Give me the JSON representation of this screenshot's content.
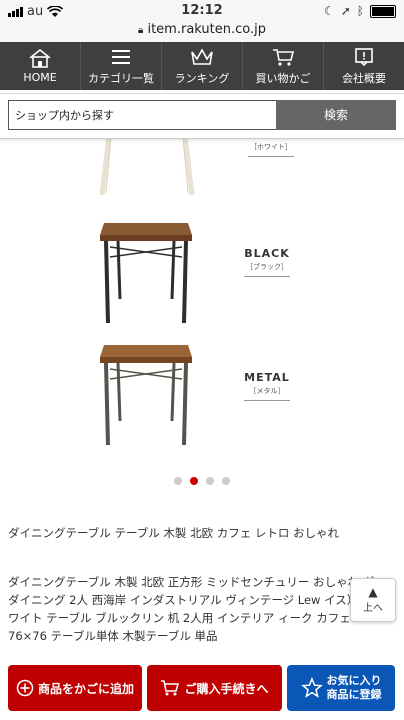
{
  "status": {
    "carrier": "au",
    "time": "12:12"
  },
  "browser": {
    "url": "item.rakuten.co.jp"
  },
  "nav": [
    {
      "label": "HOME",
      "icon": "home-icon"
    },
    {
      "label": "カテゴリ一覧",
      "icon": "menu-icon"
    },
    {
      "label": "ランキング",
      "icon": "crown-icon"
    },
    {
      "label": "買い物かご",
      "icon": "cart-icon"
    },
    {
      "label": "会社概要",
      "icon": "info-icon"
    }
  ],
  "search": {
    "placeholder": "ショップ内から探す",
    "button": "検索"
  },
  "variants": [
    {
      "en": "",
      "jp": "［ホワイト］"
    },
    {
      "en": "BLACK",
      "jp": "［ブラック］"
    },
    {
      "en": "METAL",
      "jp": "［メタル］"
    }
  ],
  "product": {
    "title": "ダイニングテーブル テーブル 木製 北欧 カフェ レトロ おしゃれ",
    "description": "ダイニングテーブル 木製 北欧 正方形 ミッドセンチュリー おしゃれ ダン ダイニング 2人 西海岸 インダストリアル ヴィンテージ Lew イス）| 白 ホワイト テーブル ブルックリン 机 2人用 インテリア ィーク カフェ 76×76 テーブル単体 木製テーブル 単品"
  },
  "scroll_top": {
    "label": "上へ"
  },
  "footer": {
    "add_to_cart": "商品をかごに追加",
    "checkout": "ご購入手続きへ",
    "favorite_line1": "お気に入り",
    "favorite_line2": "商品に登録"
  },
  "colors": {
    "brand_red": "#bf0000",
    "favorite_blue": "#0a57b8",
    "nav_bg": "#3f3f3f"
  }
}
